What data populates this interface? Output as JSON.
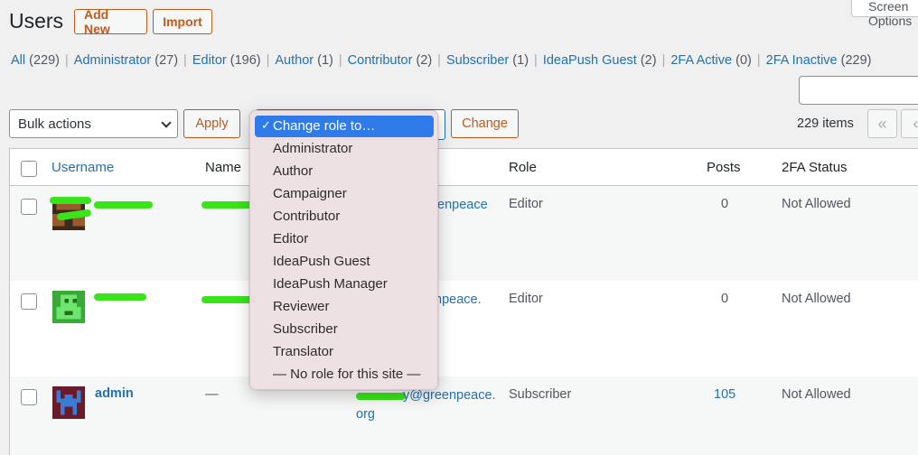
{
  "header": {
    "title": "Users",
    "add_new": "Add New",
    "import": "Import",
    "screen_options": "Screen Options"
  },
  "filters": [
    {
      "label": "All",
      "count": "(229)"
    },
    {
      "label": "Administrator",
      "count": "(27)"
    },
    {
      "label": "Editor",
      "count": "(196)"
    },
    {
      "label": "Author",
      "count": "(1)"
    },
    {
      "label": "Contributor",
      "count": "(2)"
    },
    {
      "label": "Subscriber",
      "count": "(1)"
    },
    {
      "label": "IdeaPush Guest",
      "count": "(2)"
    },
    {
      "label": "2FA Active",
      "count": "(0)"
    },
    {
      "label": "2FA Inactive",
      "count": "(229)"
    }
  ],
  "tablenav": {
    "bulk_actions": "Bulk actions",
    "apply": "Apply",
    "change": "Change",
    "items_count": "229 items",
    "first_page": "«",
    "prev_page": "‹"
  },
  "role_dropdown": {
    "selected": "Change role to…",
    "options": [
      "Administrator",
      "Author",
      "Campaigner",
      "Contributor",
      "Editor",
      "IdeaPush Guest",
      "IdeaPush Manager",
      "Reviewer",
      "Subscriber",
      "Translator",
      "— No role for this site —"
    ]
  },
  "table": {
    "columns": {
      "username": "Username",
      "name": "Name",
      "role": "Role",
      "posts": "Posts",
      "twofa": "2FA Status"
    },
    "rows": [
      {
        "username": "",
        "name": "",
        "email": "enpeace",
        "role": "Editor",
        "posts": "0",
        "twofa": "Not Allowed"
      },
      {
        "username": "",
        "name": "",
        "email": "npeace.",
        "role": "Editor",
        "posts": "0",
        "twofa": "Not Allowed"
      },
      {
        "username": "admin",
        "name": "—",
        "email": "y@greenpeace.",
        "email2": "org",
        "role": "Subscriber",
        "posts": "105",
        "twofa": "Not Allowed"
      }
    ]
  },
  "colors": {
    "accent": "#2271b1",
    "orange": "#c3581f",
    "highlight": "#2f7be9",
    "redaction": "#39e41a"
  }
}
